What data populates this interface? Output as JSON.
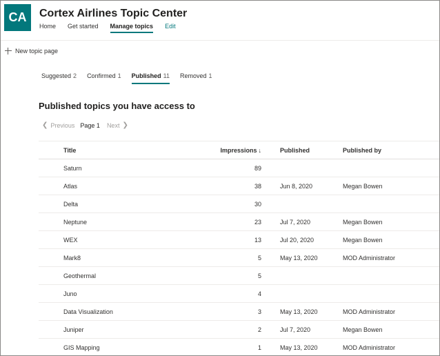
{
  "site": {
    "logo_text": "CA",
    "title": "Cortex Airlines Topic Center",
    "nav": [
      "Home",
      "Get started",
      "Manage topics",
      "Edit"
    ]
  },
  "command_bar": {
    "new_topic_label": "New topic page"
  },
  "tabs": [
    {
      "label": "Suggested",
      "count": "2"
    },
    {
      "label": "Confirmed",
      "count": "1"
    },
    {
      "label": "Published",
      "count": "11"
    },
    {
      "label": "Removed",
      "count": "1"
    }
  ],
  "section_title": "Published topics you have access to",
  "pager": {
    "previous": "Previous",
    "page": "Page 1",
    "next": "Next"
  },
  "table": {
    "columns": {
      "title": "Title",
      "impressions": "Impressions",
      "published": "Published",
      "published_by": "Published by"
    },
    "sort_indicator": "↓",
    "rows": [
      {
        "title": "Saturn",
        "impressions": "89",
        "published": "",
        "published_by": ""
      },
      {
        "title": "Atlas",
        "impressions": "38",
        "published": "Jun 8, 2020",
        "published_by": "Megan Bowen"
      },
      {
        "title": "Delta",
        "impressions": "30",
        "published": "",
        "published_by": ""
      },
      {
        "title": "Neptune",
        "impressions": "23",
        "published": "Jul 7, 2020",
        "published_by": "Megan Bowen"
      },
      {
        "title": "WEX",
        "impressions": "13",
        "published": "Jul 20, 2020",
        "published_by": "Megan Bowen"
      },
      {
        "title": "Mark8",
        "impressions": "5",
        "published": "May 13, 2020",
        "published_by": "MOD Administrator"
      },
      {
        "title": "Geothermal",
        "impressions": "5",
        "published": "",
        "published_by": ""
      },
      {
        "title": "Juno",
        "impressions": "4",
        "published": "",
        "published_by": ""
      },
      {
        "title": "Data Visualization",
        "impressions": "3",
        "published": "May 13, 2020",
        "published_by": "MOD Administrator"
      },
      {
        "title": "Juniper",
        "impressions": "2",
        "published": "Jul 7, 2020",
        "published_by": "Megan Bowen"
      },
      {
        "title": "GIS Mapping",
        "impressions": "1",
        "published": "May 13, 2020",
        "published_by": "MOD Administrator"
      }
    ]
  },
  "colors": {
    "accent": "#03787c"
  }
}
